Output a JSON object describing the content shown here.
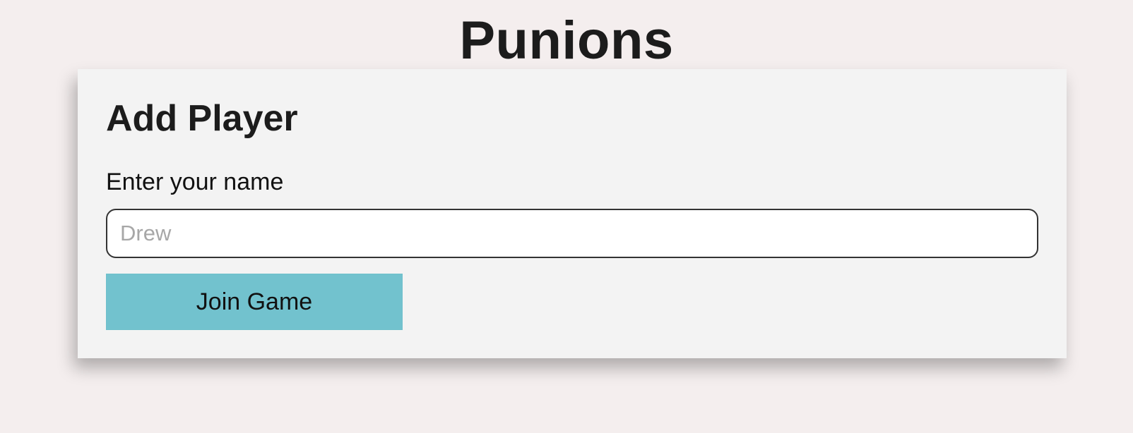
{
  "app": {
    "title": "Punions"
  },
  "add_player": {
    "title": "Add Player",
    "name_label": "Enter your name",
    "name_input": {
      "value": "",
      "placeholder": "Drew"
    },
    "join_button_label": "Join Game"
  },
  "colors": {
    "page_background": "#f4eeee",
    "card_background": "#f3f3f3",
    "button_background": "#72c2ce",
    "text": "#1c1c1c",
    "placeholder": "#a7a7a7"
  }
}
